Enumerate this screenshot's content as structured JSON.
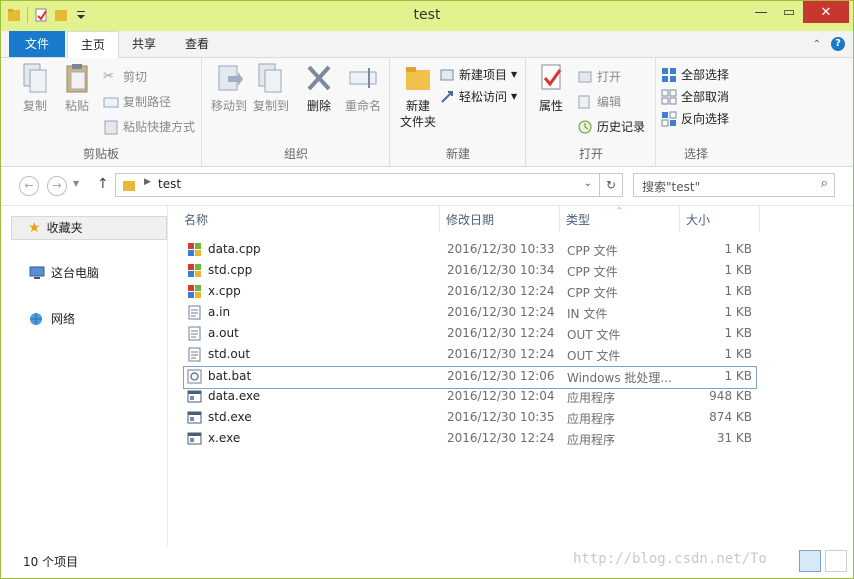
{
  "window": {
    "title": "test"
  },
  "tabs": {
    "file": "文件",
    "home": "主页",
    "share": "共享",
    "view": "查看"
  },
  "ribbon": {
    "clipboard": {
      "label": "剪贴板",
      "copy": "复制",
      "paste": "粘贴",
      "cut": "剪切",
      "copy_path": "复制路径",
      "paste_shortcut": "粘贴快捷方式"
    },
    "organize": {
      "label": "组织",
      "move_to": "移动到",
      "copy_to": "复制到",
      "delete": "删除",
      "rename": "重命名"
    },
    "new": {
      "label": "新建",
      "new_folder_line1": "新建",
      "new_folder_line2": "文件夹",
      "new_item": "新建项目",
      "easy_access": "轻松访问"
    },
    "open": {
      "label": "打开",
      "properties": "属性",
      "open": "打开",
      "edit": "编辑",
      "history": "历史记录"
    },
    "select": {
      "label": "选择",
      "select_all": "全部选择",
      "select_none": "全部取消",
      "invert": "反向选择"
    }
  },
  "address": {
    "path": "test",
    "search_placeholder": "搜索\"test\""
  },
  "navpane": {
    "favorites": "收藏夹",
    "this_pc": "这台电脑",
    "network": "网络"
  },
  "columns": {
    "name": "名称",
    "date": "修改日期",
    "type": "类型",
    "size": "大小"
  },
  "files": [
    {
      "name": "data.cpp",
      "date": "2016/12/30 10:33",
      "type": "CPP 文件",
      "size": "1 KB",
      "kind": "cpp"
    },
    {
      "name": "std.cpp",
      "date": "2016/12/30 10:34",
      "type": "CPP 文件",
      "size": "1 KB",
      "kind": "cpp"
    },
    {
      "name": "x.cpp",
      "date": "2016/12/30 12:24",
      "type": "CPP 文件",
      "size": "1 KB",
      "kind": "cpp"
    },
    {
      "name": "a.in",
      "date": "2016/12/30 12:24",
      "type": "IN 文件",
      "size": "1 KB",
      "kind": "doc"
    },
    {
      "name": "a.out",
      "date": "2016/12/30 12:24",
      "type": "OUT 文件",
      "size": "1 KB",
      "kind": "doc"
    },
    {
      "name": "std.out",
      "date": "2016/12/30 12:24",
      "type": "OUT 文件",
      "size": "1 KB",
      "kind": "doc"
    },
    {
      "name": "bat.bat",
      "date": "2016/12/30 12:06",
      "type": "Windows 批处理...",
      "size": "1 KB",
      "kind": "bat",
      "selected": true
    },
    {
      "name": "data.exe",
      "date": "2016/12/30 12:04",
      "type": "应用程序",
      "size": "948 KB",
      "kind": "exe"
    },
    {
      "name": "std.exe",
      "date": "2016/12/30 10:35",
      "type": "应用程序",
      "size": "874 KB",
      "kind": "exe"
    },
    {
      "name": "x.exe",
      "date": "2016/12/30 12:24",
      "type": "应用程序",
      "size": "31 KB",
      "kind": "exe"
    }
  ],
  "status": {
    "count": "10 个项目"
  },
  "watermark": "http://blog.csdn.net/To",
  "colors": {
    "accent": "#1979ca",
    "titlebar": "#e3f28f",
    "selection_border": "#7da2ce"
  }
}
